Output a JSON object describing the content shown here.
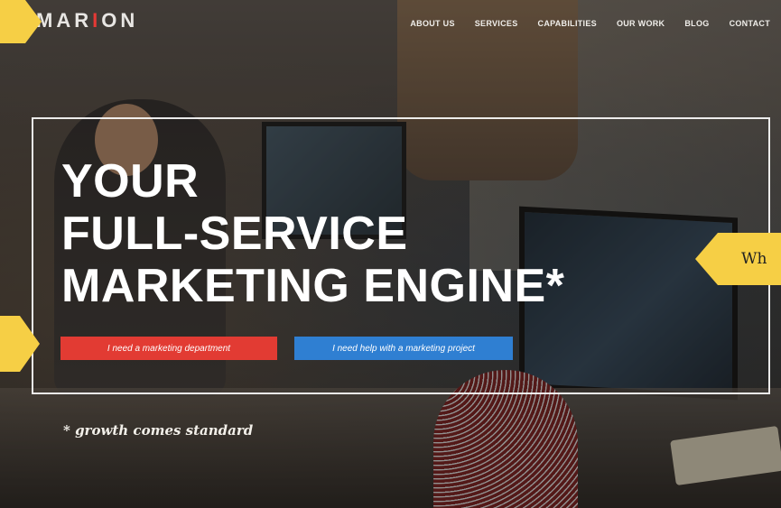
{
  "brand": {
    "logo_before": "MAR",
    "logo_accent": "I",
    "logo_after": "ON"
  },
  "nav": {
    "items": [
      {
        "label": "ABOUT US"
      },
      {
        "label": "SERVICES"
      },
      {
        "label": "CAPABILITIES"
      },
      {
        "label": "OUR WORK"
      },
      {
        "label": "BLOG"
      },
      {
        "label": "CONTACT"
      }
    ]
  },
  "hero": {
    "line1": "YOUR",
    "line2": "FULL-SERVICE",
    "line3": "MARKETING ENGINE*",
    "cta_primary": "I need a marketing department",
    "cta_secondary": "I need help with a marketing project",
    "tagline": "* growth comes standard"
  },
  "annotation": {
    "callout_text": "Wh"
  },
  "colors": {
    "accent_red": "#e23b33",
    "accent_blue": "#2f7fd2",
    "callout_yellow": "#f6cf45"
  }
}
